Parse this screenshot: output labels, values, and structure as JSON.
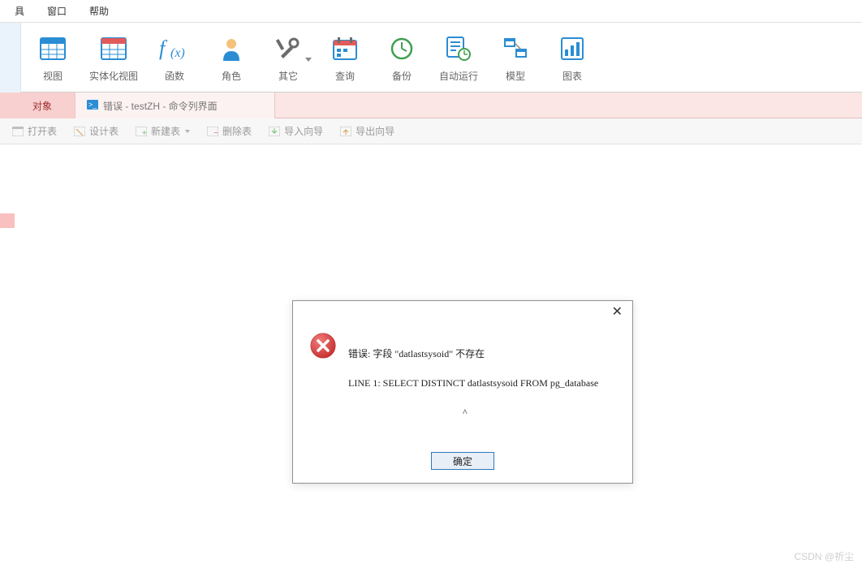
{
  "menubar": {
    "items": [
      "具",
      "窗口",
      "帮助"
    ]
  },
  "toolbar": {
    "buttons": [
      {
        "name": "view-button",
        "label": "视图",
        "icon": "grid-icon",
        "hasCaret": false
      },
      {
        "name": "materialized-view-button",
        "label": "实体化视图",
        "icon": "grid-red-icon",
        "hasCaret": false
      },
      {
        "name": "function-button",
        "label": "函数",
        "icon": "fx-icon",
        "hasCaret": false
      },
      {
        "name": "role-button",
        "label": "角色",
        "icon": "person-icon",
        "hasCaret": false
      },
      {
        "name": "other-button",
        "label": "其它",
        "icon": "tools-icon",
        "hasCaret": true
      },
      {
        "name": "query-button",
        "label": "查询",
        "icon": "calendar-icon",
        "hasCaret": false
      },
      {
        "name": "backup-button",
        "label": "备份",
        "icon": "clock-icon",
        "hasCaret": false
      },
      {
        "name": "auto-run-button",
        "label": "自动运行",
        "icon": "schedule-icon",
        "hasCaret": false
      },
      {
        "name": "model-button",
        "label": "模型",
        "icon": "model-icon",
        "hasCaret": false
      },
      {
        "name": "chart-button",
        "label": "图表",
        "icon": "chart-icon",
        "hasCaret": false
      }
    ]
  },
  "tabs": {
    "items": [
      {
        "name": "tab-objects",
        "label": "对象",
        "active": true
      },
      {
        "name": "tab-error-cli",
        "label": "错误 - testZH - 命令列界面",
        "active": false,
        "iconName": "terminal-icon"
      }
    ]
  },
  "secondaryToolbar": {
    "buttons": [
      {
        "name": "open-table-button",
        "label": "打开表",
        "caret": false
      },
      {
        "name": "design-table-button",
        "label": "设计表",
        "caret": false
      },
      {
        "name": "new-table-button",
        "label": "新建表",
        "caret": true
      },
      {
        "name": "delete-table-button",
        "label": "删除表",
        "caret": false
      },
      {
        "name": "import-wizard-button",
        "label": "导入向导",
        "caret": false
      },
      {
        "name": "export-wizard-button",
        "label": "导出向导",
        "caret": false
      }
    ]
  },
  "dialog": {
    "line1": "错误:  字段 \"datlastsysoid\" 不存在",
    "line2": "LINE 1: SELECT DISTINCT datlastsysoid FROM pg_database",
    "line3": "                                               ^",
    "okLabel": "确定"
  },
  "watermark": "CSDN @祈尘"
}
